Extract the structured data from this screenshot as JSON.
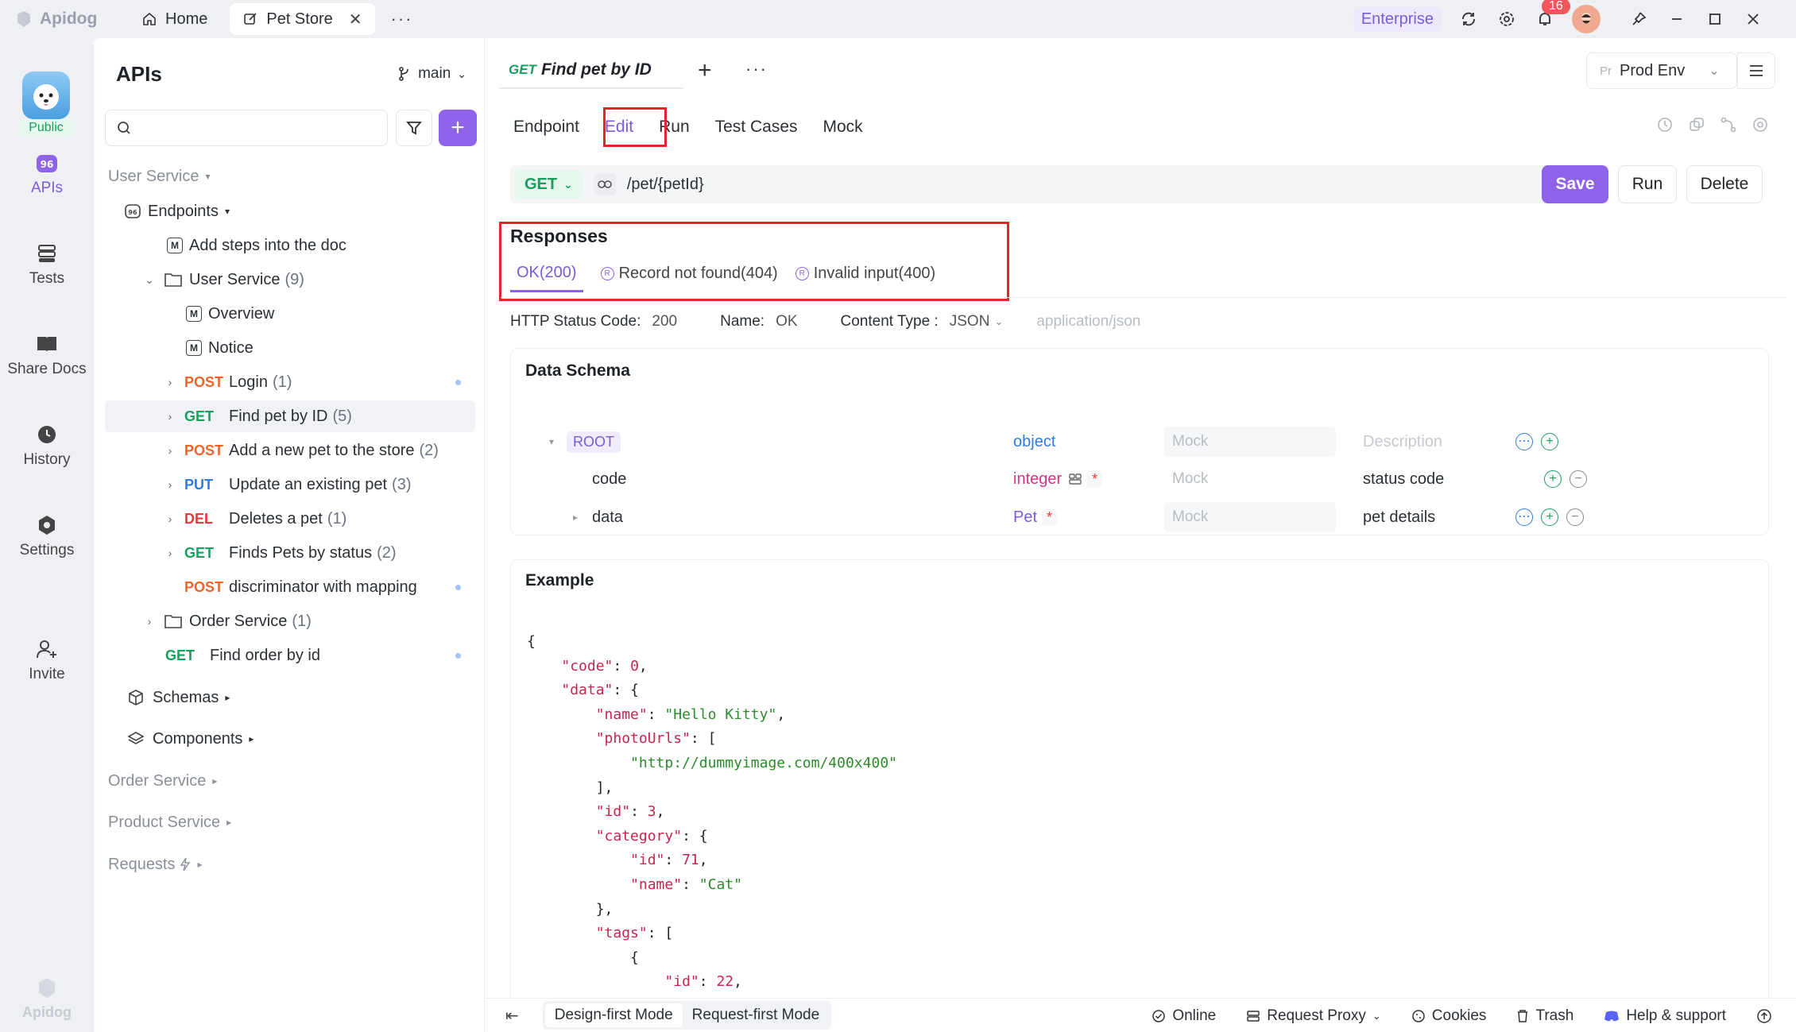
{
  "app": {
    "brand": "Apidog"
  },
  "top_tabs": [
    {
      "label": "Home",
      "icon": "home-icon"
    },
    {
      "label": "Pet Store",
      "icon": "edit-icon",
      "active": true
    }
  ],
  "top_right": {
    "plan": "Enterprise",
    "notifications": "16"
  },
  "left_nav": {
    "project_tag": "Public",
    "items": [
      {
        "label": "APIs",
        "icon": "apis-icon",
        "active": true
      },
      {
        "label": "Tests",
        "icon": "tests-icon"
      },
      {
        "label": "Share Docs",
        "icon": "book-icon"
      },
      {
        "label": "History",
        "icon": "clock-icon"
      },
      {
        "label": "Settings",
        "icon": "gear-icon"
      },
      {
        "label": "Invite",
        "icon": "invite-icon"
      }
    ],
    "footer_logo": "Apidog"
  },
  "sidebar": {
    "title": "APIs",
    "branch": "main",
    "search_placeholder": "",
    "tree": [
      {
        "kind": "group",
        "label": "User Service"
      },
      {
        "kind": "folder",
        "label": "Endpoints"
      },
      {
        "kind": "doc",
        "label": "Add steps into the doc"
      },
      {
        "kind": "folder",
        "label": "User Service",
        "count": "(9)"
      },
      {
        "kind": "doc",
        "label": "Overview"
      },
      {
        "kind": "doc",
        "label": "Notice"
      },
      {
        "kind": "api",
        "method": "POST",
        "label": "Login",
        "count": "(1)"
      },
      {
        "kind": "api",
        "method": "GET",
        "label": "Find pet by ID",
        "count": "(5)",
        "selected": true
      },
      {
        "kind": "api",
        "method": "POST",
        "label": "Add a new pet to the store",
        "count": "(2)"
      },
      {
        "kind": "api",
        "method": "PUT",
        "label": "Update an existing pet",
        "count": "(3)"
      },
      {
        "kind": "api",
        "method": "DEL",
        "label": "Deletes a pet",
        "count": "(1)"
      },
      {
        "kind": "api",
        "method": "GET",
        "label": "Finds Pets by status",
        "count": "(2)"
      },
      {
        "kind": "api",
        "method": "POST",
        "label": "discriminator with mapping"
      },
      {
        "kind": "folder",
        "label": "Order Service",
        "count": "(1)"
      },
      {
        "kind": "api",
        "method": "GET",
        "label": "Find order by id"
      },
      {
        "kind": "section",
        "label": "Schemas"
      },
      {
        "kind": "section",
        "label": "Components"
      },
      {
        "kind": "group",
        "label": "Order Service"
      },
      {
        "kind": "group",
        "label": "Product Service"
      },
      {
        "kind": "group",
        "label": "Requests"
      }
    ]
  },
  "main": {
    "doc_tab": {
      "method": "GET",
      "title": "Find pet by ID"
    },
    "env": {
      "prefix": "Pr",
      "name": "Prod Env"
    },
    "sub_tabs": [
      "Endpoint",
      "Edit",
      "Run",
      "Test Cases",
      "Mock"
    ],
    "active_sub_tab": "Edit",
    "url": {
      "method": "GET",
      "path": "/pet/{petId}"
    },
    "buttons": {
      "save": "Save",
      "run": "Run",
      "delete": "Delete"
    },
    "responses": {
      "title": "Responses",
      "tabs": [
        {
          "label": "OK(200)",
          "active": true
        },
        {
          "label": "Record not found(404)"
        },
        {
          "label": "Invalid input(400)"
        }
      ],
      "status_code_label": "HTTP Status Code:",
      "status_code": "200",
      "name_label": "Name:",
      "name": "OK",
      "content_type_label": "Content Type :",
      "content_type": "JSON",
      "content_type_value": "application/json"
    },
    "schema": {
      "title": "Data Schema",
      "rows": [
        {
          "name": "ROOT",
          "type": "object",
          "mock": "Mock",
          "description": "Description",
          "description_placeholder": true
        },
        {
          "name": "code",
          "type": "integer",
          "required": "*",
          "mock": "Mock",
          "description": "status code"
        },
        {
          "name": "data",
          "type": "Pet",
          "required": "*",
          "mock": "Mock",
          "description": "pet details"
        }
      ]
    },
    "example": {
      "title": "Example",
      "lines": [
        "{",
        "    \"code\": 0,",
        "    \"data\": {",
        "        \"name\": \"Hello Kitty\",",
        "        \"photoUrls\": [",
        "            \"http://dummyimage.com/400x400\"",
        "        ],",
        "        \"id\": 3,",
        "        \"category\": {",
        "            \"id\": 71,",
        "            \"name\": \"Cat\"",
        "        },",
        "        \"tags\": [",
        "            {",
        "                \"id\": 22,"
      ]
    }
  },
  "statusbar": {
    "modes": [
      "Design-first Mode",
      "Request-first Mode"
    ],
    "active_mode": "Design-first Mode",
    "items": [
      "Online",
      "Request Proxy",
      "Cookies",
      "Trash",
      "Help & support"
    ]
  },
  "colors": {
    "accent": "#8e63ea",
    "get": "#17a05d",
    "post": "#f0642a",
    "put": "#2f7be5",
    "delete": "#e8393f",
    "highlight": "#e2262b"
  }
}
